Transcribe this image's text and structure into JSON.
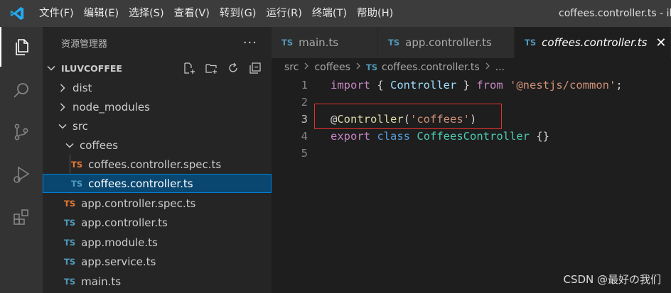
{
  "titlebar": {
    "menu": [
      "文件(F)",
      "编辑(E)",
      "选择(S)",
      "查看(V)",
      "转到(G)",
      "运行(R)",
      "终端(T)",
      "帮助(H)"
    ],
    "window_title": "coffees.controller.ts - iluvcoffee"
  },
  "activity_icons": [
    "explorer-icon",
    "search-icon",
    "source-control-icon",
    "run-debug-icon",
    "extensions-icon"
  ],
  "sidebar": {
    "title": "资源管理器",
    "more": "···",
    "folder": "ILUVCOFFEE",
    "tree": [
      {
        "label": "dist",
        "type": "folder",
        "expanded": false
      },
      {
        "label": "node_modules",
        "type": "folder",
        "expanded": false
      },
      {
        "label": "src",
        "type": "folder",
        "expanded": true
      },
      {
        "label": "coffees",
        "type": "folder",
        "expanded": true
      },
      {
        "label": "coffees.controller.spec.ts",
        "type": "file",
        "badge": "TS",
        "badge_color": "#e37933"
      },
      {
        "label": "coffees.controller.ts",
        "type": "file",
        "badge": "TS",
        "badge_color": "#519aba",
        "selected": true
      },
      {
        "label": "app.controller.spec.ts",
        "type": "file",
        "badge": "TS",
        "badge_color": "#e37933"
      },
      {
        "label": "app.controller.ts",
        "type": "file",
        "badge": "TS",
        "badge_color": "#519aba"
      },
      {
        "label": "app.module.ts",
        "type": "file",
        "badge": "TS",
        "badge_color": "#519aba"
      },
      {
        "label": "app.service.ts",
        "type": "file",
        "badge": "TS",
        "badge_color": "#519aba"
      },
      {
        "label": "main.ts",
        "type": "file",
        "badge": "TS",
        "badge_color": "#519aba"
      }
    ]
  },
  "tabs": [
    {
      "badge": "TS",
      "label": "main.ts",
      "active": false
    },
    {
      "badge": "TS",
      "label": "app.controller.ts",
      "active": false
    },
    {
      "badge": "TS",
      "label": "coffees.controller.ts",
      "active": true,
      "close": "✕"
    }
  ],
  "breadcrumb": {
    "parts": [
      "src",
      "coffees"
    ],
    "file_badge": "TS",
    "file": "coffees.controller.ts",
    "tail": "..."
  },
  "code": {
    "line_numbers": [
      "1",
      "2",
      "3",
      "4",
      "5"
    ],
    "current_line": "3",
    "lines": [
      [
        {
          "t": "import",
          "c": "kw"
        },
        {
          "t": " { ",
          "c": "pl"
        },
        {
          "t": "Controller",
          "c": "var"
        },
        {
          "t": " } ",
          "c": "pl"
        },
        {
          "t": "from",
          "c": "kw"
        },
        {
          "t": " ",
          "c": "pl"
        },
        {
          "t": "'@nestjs/common'",
          "c": "str"
        },
        {
          "t": ";",
          "c": "pl"
        }
      ],
      [],
      [
        {
          "t": "@",
          "c": "pl"
        },
        {
          "t": "Controller",
          "c": "dec"
        },
        {
          "t": "(",
          "c": "pl"
        },
        {
          "t": "'coffees'",
          "c": "str"
        },
        {
          "t": ")",
          "c": "pl"
        }
      ],
      [
        {
          "t": "export",
          "c": "kw"
        },
        {
          "t": " ",
          "c": "pl"
        },
        {
          "t": "class",
          "c": "kw2"
        },
        {
          "t": " ",
          "c": "pl"
        },
        {
          "t": "CoffeesController",
          "c": "cls"
        },
        {
          "t": " {}",
          "c": "pl"
        }
      ],
      []
    ]
  },
  "watermark": "CSDN @最好の我们",
  "colors": {
    "titlebar": "#3c3c3c",
    "activitybar": "#333333",
    "sidebar": "#252526",
    "editor": "#1e1e1e",
    "selection": "#094771",
    "highlight_box": "#e0312d"
  }
}
